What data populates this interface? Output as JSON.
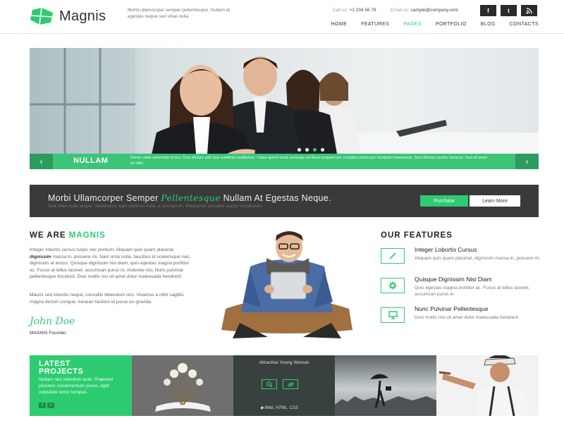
{
  "header": {
    "brand": "Magnis",
    "tagline": "Morbi ullamcorper semper pellentesque. Nullam at egestas neque sed vitae nulla.",
    "phone_label": "Call us:",
    "phone": "+1 234 56 78",
    "email_label": "Email us:",
    "email": "sample@company.com",
    "social": [
      {
        "icon": "facebook-icon",
        "glyph": "f"
      },
      {
        "icon": "twitter-icon",
        "glyph": "t"
      },
      {
        "icon": "rss-icon",
        "glyph": "rss"
      }
    ]
  },
  "nav": {
    "items": [
      "HOME",
      "FEATURES",
      "PAGES",
      "PORTFOLIO",
      "BLOG",
      "CONTACTS"
    ],
    "active": "PAGES"
  },
  "slider": {
    "title": "NULLAM",
    "text": "Donec vitae venenatis lectus. Duis dictum velit quis eleifend vestibulum. Class aptent taciti sociosqu ad litora torquent per conubia nostra per inceptos himenaeos. Sed ultricies auctor rhoncus. Sed sit amet mi nibh.",
    "prev": "‹",
    "next": "›",
    "slide_count": 4,
    "active_slide": 3
  },
  "banner": {
    "headline_before": "Morbi Ullamcorper Semper ",
    "headline_highlight": "Pellentesque",
    "headline_after": " Nullam At Egestas Neque.",
    "subtext": "Sed vitae nulla augue. Vestibulum eget eleifend nulla, a suscipit mi. Maecenas posuere auctor vestibulum.",
    "purchase_label": "Purchase",
    "learn_label": "Learn More"
  },
  "about": {
    "title_prefix": "WE ARE ",
    "title_brand": "MAGNIS",
    "p1_a": "Integer lobortis cursus turpis nec pretium. Aliquam quis quam placerat, ",
    "p1_b": "dignissim",
    "p1_c": " massa in, posuere mi. Nam urna nulla, faucibus id scelerisque nec, dignissim at lectus. Quisque dignissim nisi diam, quis egestas magna porttitor ac. Fusce at tellus laoreet, accumsan purus in, molestie nisi. Nunc pulvinar pellentesque tincidunt. Duis mollis nisi sit amet dolor malesuada hendrerit.",
    "p2": "Mauris sed lobortis neque, convallis bibendum orci. Vivamus a nibh sagittis magna dictum congue. Aenean facilisis id purus eu gravida.",
    "signature": "John Doe",
    "role": "MAGNIS Founder"
  },
  "features": {
    "title": "OUR FEATURES",
    "items": [
      {
        "icon": "magic-wand-icon",
        "title": "Integer Lobortis Cursus",
        "text": "Aliquam quis quam placerat, dignissim massa in, posuere mi."
      },
      {
        "icon": "gear-icon",
        "title": "Quisque Dignissim Nisi Diam",
        "text": "Quis egestas magna porttitor ac. Fusce at tellus laoreet, accumsan purus in."
      },
      {
        "icon": "monitor-icon",
        "title": "Nunc Pulvinar Pellentesque",
        "text": "Duis mollis nisi sit amet dolor malesuada hendrerit."
      }
    ]
  },
  "projects": {
    "title_line1": "LATEST",
    "title_line2": "PROJECTS",
    "desc": "Nullam nec interdum ante. Praesent posuere condimentum purus, eget vulputate tortor tempus.",
    "prev": "‹",
    "next": "›",
    "hover_caption": "Attractive Young Woman",
    "hover_tags": "Web, HTML, CSS"
  },
  "colors": {
    "accent": "#2ecc71",
    "dark_banner": "#3a3a3a"
  }
}
